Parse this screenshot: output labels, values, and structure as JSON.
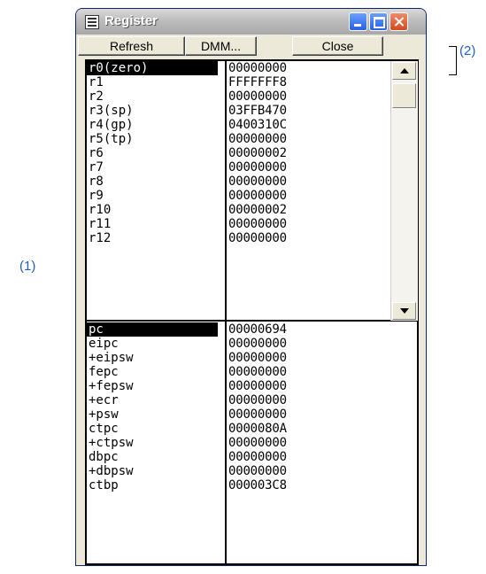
{
  "callouts": {
    "one": "(1)",
    "two": "(2)"
  },
  "window": {
    "title": "Register"
  },
  "toolbar": {
    "refresh_label": "Refresh",
    "dmm_label": "DMM...",
    "close_label": "Close"
  },
  "gpr": [
    {
      "name": "r0(zero)",
      "value": "00000000",
      "selected": true
    },
    {
      "name": "r1",
      "value": "FFFFFFF8"
    },
    {
      "name": "r2",
      "value": "00000000"
    },
    {
      "name": "r3(sp)",
      "value": "03FFB470"
    },
    {
      "name": "r4(gp)",
      "value": "0400310C"
    },
    {
      "name": "r5(tp)",
      "value": "00000000"
    },
    {
      "name": "r6",
      "value": "00000002"
    },
    {
      "name": "r7",
      "value": "00000000"
    },
    {
      "name": "r8",
      "value": "00000000"
    },
    {
      "name": "r9",
      "value": "00000000"
    },
    {
      "name": "r10",
      "value": "00000002"
    },
    {
      "name": "r11",
      "value": "00000000"
    },
    {
      "name": "r12",
      "value": "00000000"
    }
  ],
  "sysreg": [
    {
      "name": "pc",
      "value": "00000694",
      "selected": true
    },
    {
      "name": "eipc",
      "value": "00000000"
    },
    {
      "name": "+eipsw",
      "value": "00000000"
    },
    {
      "name": "fepc",
      "value": "00000000"
    },
    {
      "name": "+fepsw",
      "value": "00000000"
    },
    {
      "name": "+ecr",
      "value": "00000000"
    },
    {
      "name": "+psw",
      "value": "00000000"
    },
    {
      "name": "ctpc",
      "value": "0000080A"
    },
    {
      "name": "+ctpsw",
      "value": "00000000"
    },
    {
      "name": "dbpc",
      "value": "00000000"
    },
    {
      "name": "+dbpsw",
      "value": "00000000"
    },
    {
      "name": "ctbp",
      "value": "000003C8"
    }
  ]
}
